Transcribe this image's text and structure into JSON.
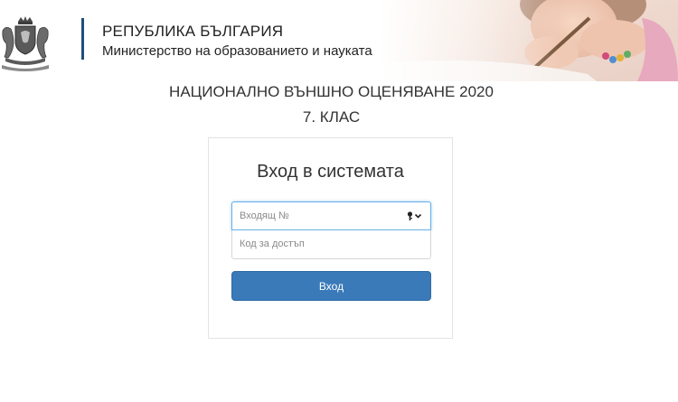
{
  "header": {
    "line1": "РЕПУБЛИКА БЪЛГАРИЯ",
    "line2": "Министерство на образованието и науката",
    "emblem_icon": "coat-of-arms-icon",
    "divider_color": "#1e4f7a"
  },
  "exam": {
    "title": "НАЦИОНАЛНО ВЪНШНО ОЦЕНЯВАНЕ 2020",
    "grade": "7. КЛАС"
  },
  "login": {
    "title": "Вход в системата",
    "number_field": {
      "placeholder": "Входящ №",
      "value": "",
      "icon": "key-dropdown-icon"
    },
    "code_field": {
      "placeholder": "Код за достъп",
      "value": ""
    },
    "submit_label": "Вход",
    "button_color": "#3a7ab8",
    "focus_color": "#66afe9"
  }
}
